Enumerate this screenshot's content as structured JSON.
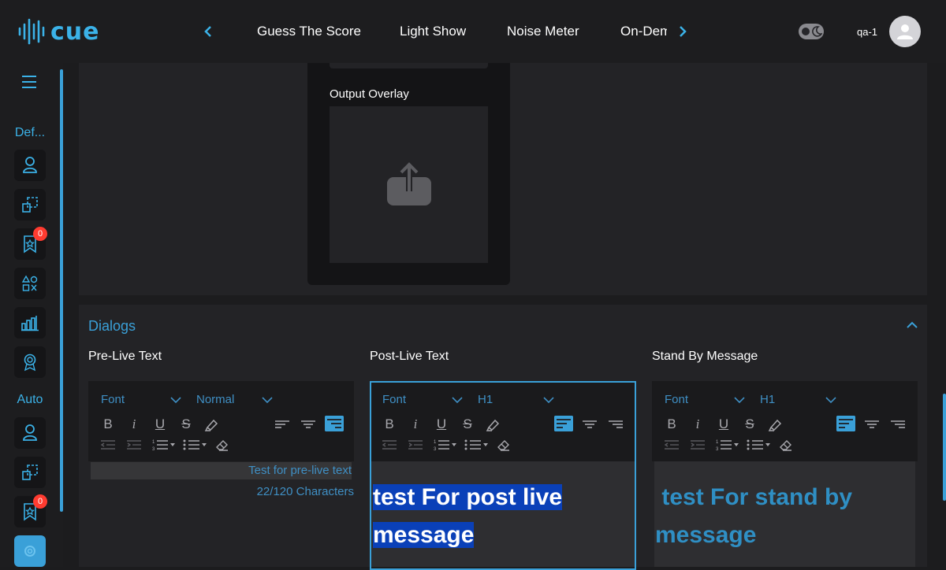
{
  "app": {
    "name": "cue",
    "username": "qa-1"
  },
  "nav": {
    "items": [
      "Guess The Score",
      "Light Show",
      "Noise Meter",
      "On-Dem"
    ]
  },
  "sidebar": {
    "sections": [
      {
        "label": "Def...",
        "badge": "0"
      },
      {
        "label": "Auto",
        "badge": "0"
      }
    ]
  },
  "upper": {
    "overlay_label": "Output Overlay"
  },
  "dialogs": {
    "title": "Dialogs",
    "columns": [
      {
        "label": "Pre-Live Text",
        "font": "Font",
        "size": "Normal",
        "text": "Test for pre-live text",
        "count": "22/120 Characters"
      },
      {
        "label": "Post-Live Text",
        "font": "Font",
        "size": "H1",
        "line1": "test For post live ",
        "line2": "message"
      },
      {
        "label": "Stand By Message",
        "font": "Font",
        "size": "H1",
        "line1": " test For stand by",
        "line2": "message"
      }
    ]
  },
  "colors": {
    "accent": "#3aa0d8",
    "badge": "#ff3b30",
    "selection": "#0a40b8"
  }
}
